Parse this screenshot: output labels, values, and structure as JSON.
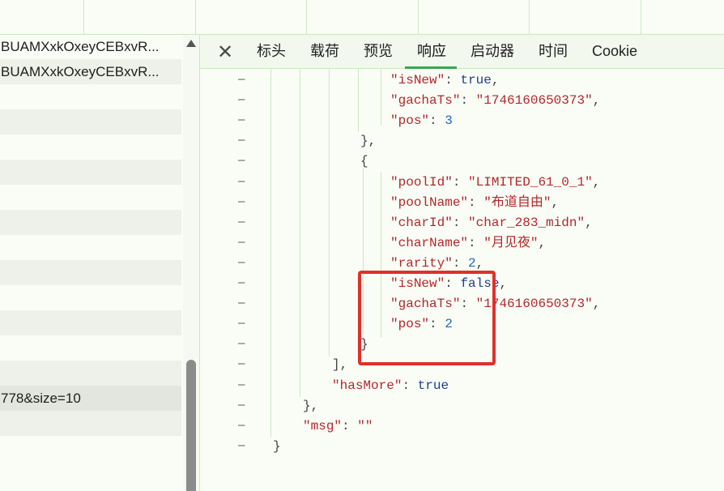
{
  "request_list": [
    {
      "text": "BUAMXxkOxeyCEBxvR...",
      "style": "normal"
    },
    {
      "text": "BUAMXxkOxeyCEBxvR...",
      "style": "alt"
    },
    {
      "text": "",
      "style": "normal"
    },
    {
      "text": "",
      "style": "alt"
    },
    {
      "text": "",
      "style": "normal"
    },
    {
      "text": "",
      "style": "alt"
    },
    {
      "text": "",
      "style": "normal"
    },
    {
      "text": "",
      "style": "alt"
    },
    {
      "text": "",
      "style": "normal"
    },
    {
      "text": "",
      "style": "alt"
    },
    {
      "text": "",
      "style": "normal"
    },
    {
      "text": "",
      "style": "alt"
    },
    {
      "text": "",
      "style": "normal"
    },
    {
      "text": "",
      "style": "alt"
    },
    {
      "text": "778&size=10",
      "style": "sel"
    },
    {
      "text": "",
      "style": "alt"
    },
    {
      "text": "",
      "style": "normal"
    }
  ],
  "tabs": {
    "close_label": "✕",
    "items": [
      "标头",
      "载荷",
      "预览",
      "响应",
      "启动器",
      "时间",
      "Cookie"
    ],
    "active": "响应"
  },
  "code": {
    "lines": [
      {
        "indent": 0,
        "key": "isNew",
        "value": "true",
        "vtype": "bool",
        "trail": ","
      },
      {
        "indent": 0,
        "key": "gachaTs",
        "value": "1746160650373",
        "vtype": "str",
        "trail": ","
      },
      {
        "indent": 0,
        "key": "pos",
        "value": "3",
        "vtype": "num",
        "trail": ""
      },
      {
        "indent": 1,
        "punct": "},"
      },
      {
        "indent": 1,
        "punct": "{"
      },
      {
        "indent": 0,
        "key": "poolId",
        "value": "LIMITED_61_0_1",
        "vtype": "str",
        "trail": ","
      },
      {
        "indent": 0,
        "key": "poolName",
        "value": "布道自由",
        "vtype": "str",
        "trail": ","
      },
      {
        "indent": 0,
        "key": "charId",
        "value": "char_283_midn",
        "vtype": "str",
        "trail": ","
      },
      {
        "indent": 0,
        "key": "charName",
        "value": "月见夜",
        "vtype": "str",
        "trail": ","
      },
      {
        "indent": 0,
        "key": "rarity",
        "value": "2",
        "vtype": "num",
        "trail": ","
      },
      {
        "indent": 0,
        "key": "isNew",
        "value": "false",
        "vtype": "bool",
        "trail": ","
      },
      {
        "indent": 0,
        "key": "gachaTs",
        "value": "1746160650373",
        "vtype": "str",
        "trail": ","
      },
      {
        "indent": 0,
        "key": "pos",
        "value": "2",
        "vtype": "num",
        "trail": ""
      },
      {
        "indent": 1,
        "punct": "}"
      },
      {
        "indent": 2,
        "punct": "],"
      },
      {
        "indent": 2,
        "key": "hasMore",
        "value": "true",
        "vtype": "bool",
        "trail": ""
      },
      {
        "indent": 3,
        "punct": "},"
      },
      {
        "indent": 3,
        "key": "msg",
        "value": "",
        "vtype": "str",
        "trail": ""
      },
      {
        "indent": 4,
        "punct": "}"
      }
    ]
  },
  "colors": {
    "highlight_box": "#e0302a",
    "active_tab_underline": "#36a852"
  }
}
